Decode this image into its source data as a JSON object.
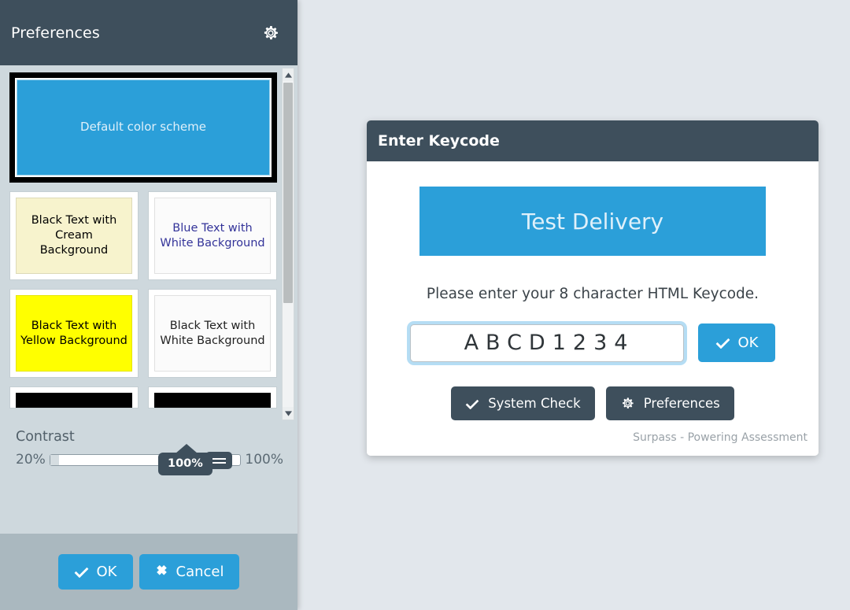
{
  "preferences_panel": {
    "header": {
      "title": "Preferences",
      "gear_icon": "gear-icon"
    },
    "color_schemes": [
      {
        "label": "Default color scheme",
        "bg": "#2b9fd9",
        "fg": "#dff0fa",
        "selected": true,
        "full_width": true
      },
      {
        "label": "Black Text with Cream Background",
        "bg": "#f7f3cd",
        "fg": "#000000",
        "selected": false,
        "full_width": false
      },
      {
        "label": "Blue Text with White Background",
        "bg": "#fbfbfb",
        "fg": "#333399",
        "selected": false,
        "full_width": false
      },
      {
        "label": "Black Text with Yellow Background",
        "bg": "#ffff00",
        "fg": "#000000",
        "selected": false,
        "full_width": false
      },
      {
        "label": "Black Text with White Background",
        "bg": "#fbfbfb",
        "fg": "#222222",
        "selected": false,
        "full_width": false
      },
      {
        "label": "",
        "bg": "#000000",
        "fg": "#ffffff",
        "selected": false,
        "full_width": false
      },
      {
        "label": "",
        "bg": "#000000",
        "fg": "#ffffff",
        "selected": false,
        "full_width": false
      }
    ],
    "contrast": {
      "label": "Contrast",
      "min_label": "20%",
      "max_label": "100%",
      "value_label": "100%",
      "value": 100,
      "min": 20,
      "max": 100
    },
    "footer": {
      "ok_label": "OK",
      "cancel_label": "Cancel",
      "ok_icon": "check-icon",
      "cancel_icon": "cross-icon"
    }
  },
  "keycode_dialog": {
    "title": "Enter Keycode",
    "banner_label": "Test Delivery",
    "instruction": "Please enter your 8 character HTML Keycode.",
    "keycode_value": "ABCD1234",
    "keycode_placeholder": "",
    "ok_label": "OK",
    "ok_icon": "check-icon",
    "system_check_label": "System Check",
    "system_check_icon": "check-icon",
    "preferences_label": "Preferences",
    "preferences_icon": "gear-icon",
    "footer_note": "Surpass - Powering Assessment"
  },
  "colors": {
    "accent_blue": "#2b9fd9",
    "dark_slate": "#3e4f5c",
    "panel_bg": "#ced8dd",
    "panel_footer_bg": "#aab8bf",
    "page_bg": "#e2e7ec"
  }
}
